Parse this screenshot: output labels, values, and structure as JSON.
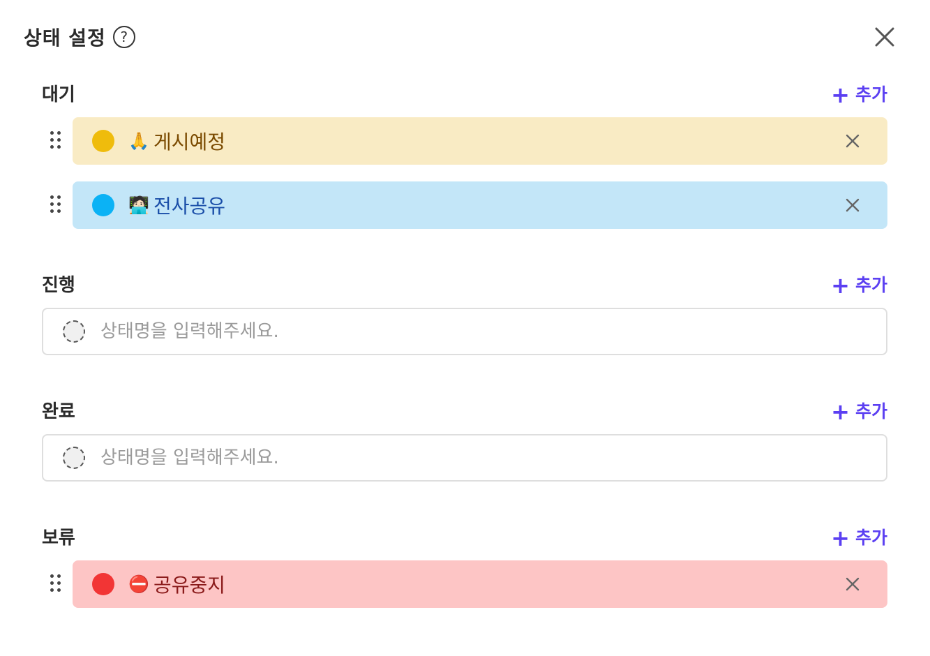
{
  "header": {
    "title": "상태 설정",
    "help_icon": "?"
  },
  "add_label": "추가",
  "add_plus": "+",
  "sections": {
    "waiting": {
      "title": "대기",
      "items": [
        {
          "emoji": "🙏",
          "label": "게시예정",
          "dot_color": "#efbc0c",
          "bg_color": "#f9ebc4",
          "text_color": "#7a4a00"
        },
        {
          "emoji": "🧑🏻‍💻",
          "label": "전사공유",
          "dot_color": "#0bb2f5",
          "bg_color": "#c3e6f8",
          "text_color": "#1a4ea8"
        }
      ]
    },
    "in_progress": {
      "title": "진행",
      "placeholder": "상태명을 입력해주세요."
    },
    "done": {
      "title": "완료",
      "placeholder": "상태명을 입력해주세요."
    },
    "hold": {
      "title": "보류",
      "items": [
        {
          "emoji": "⛔",
          "label": "공유중지",
          "dot_color": "#f23535",
          "bg_color": "#fdc5c5",
          "text_color": "#8a1a1a"
        }
      ]
    }
  }
}
